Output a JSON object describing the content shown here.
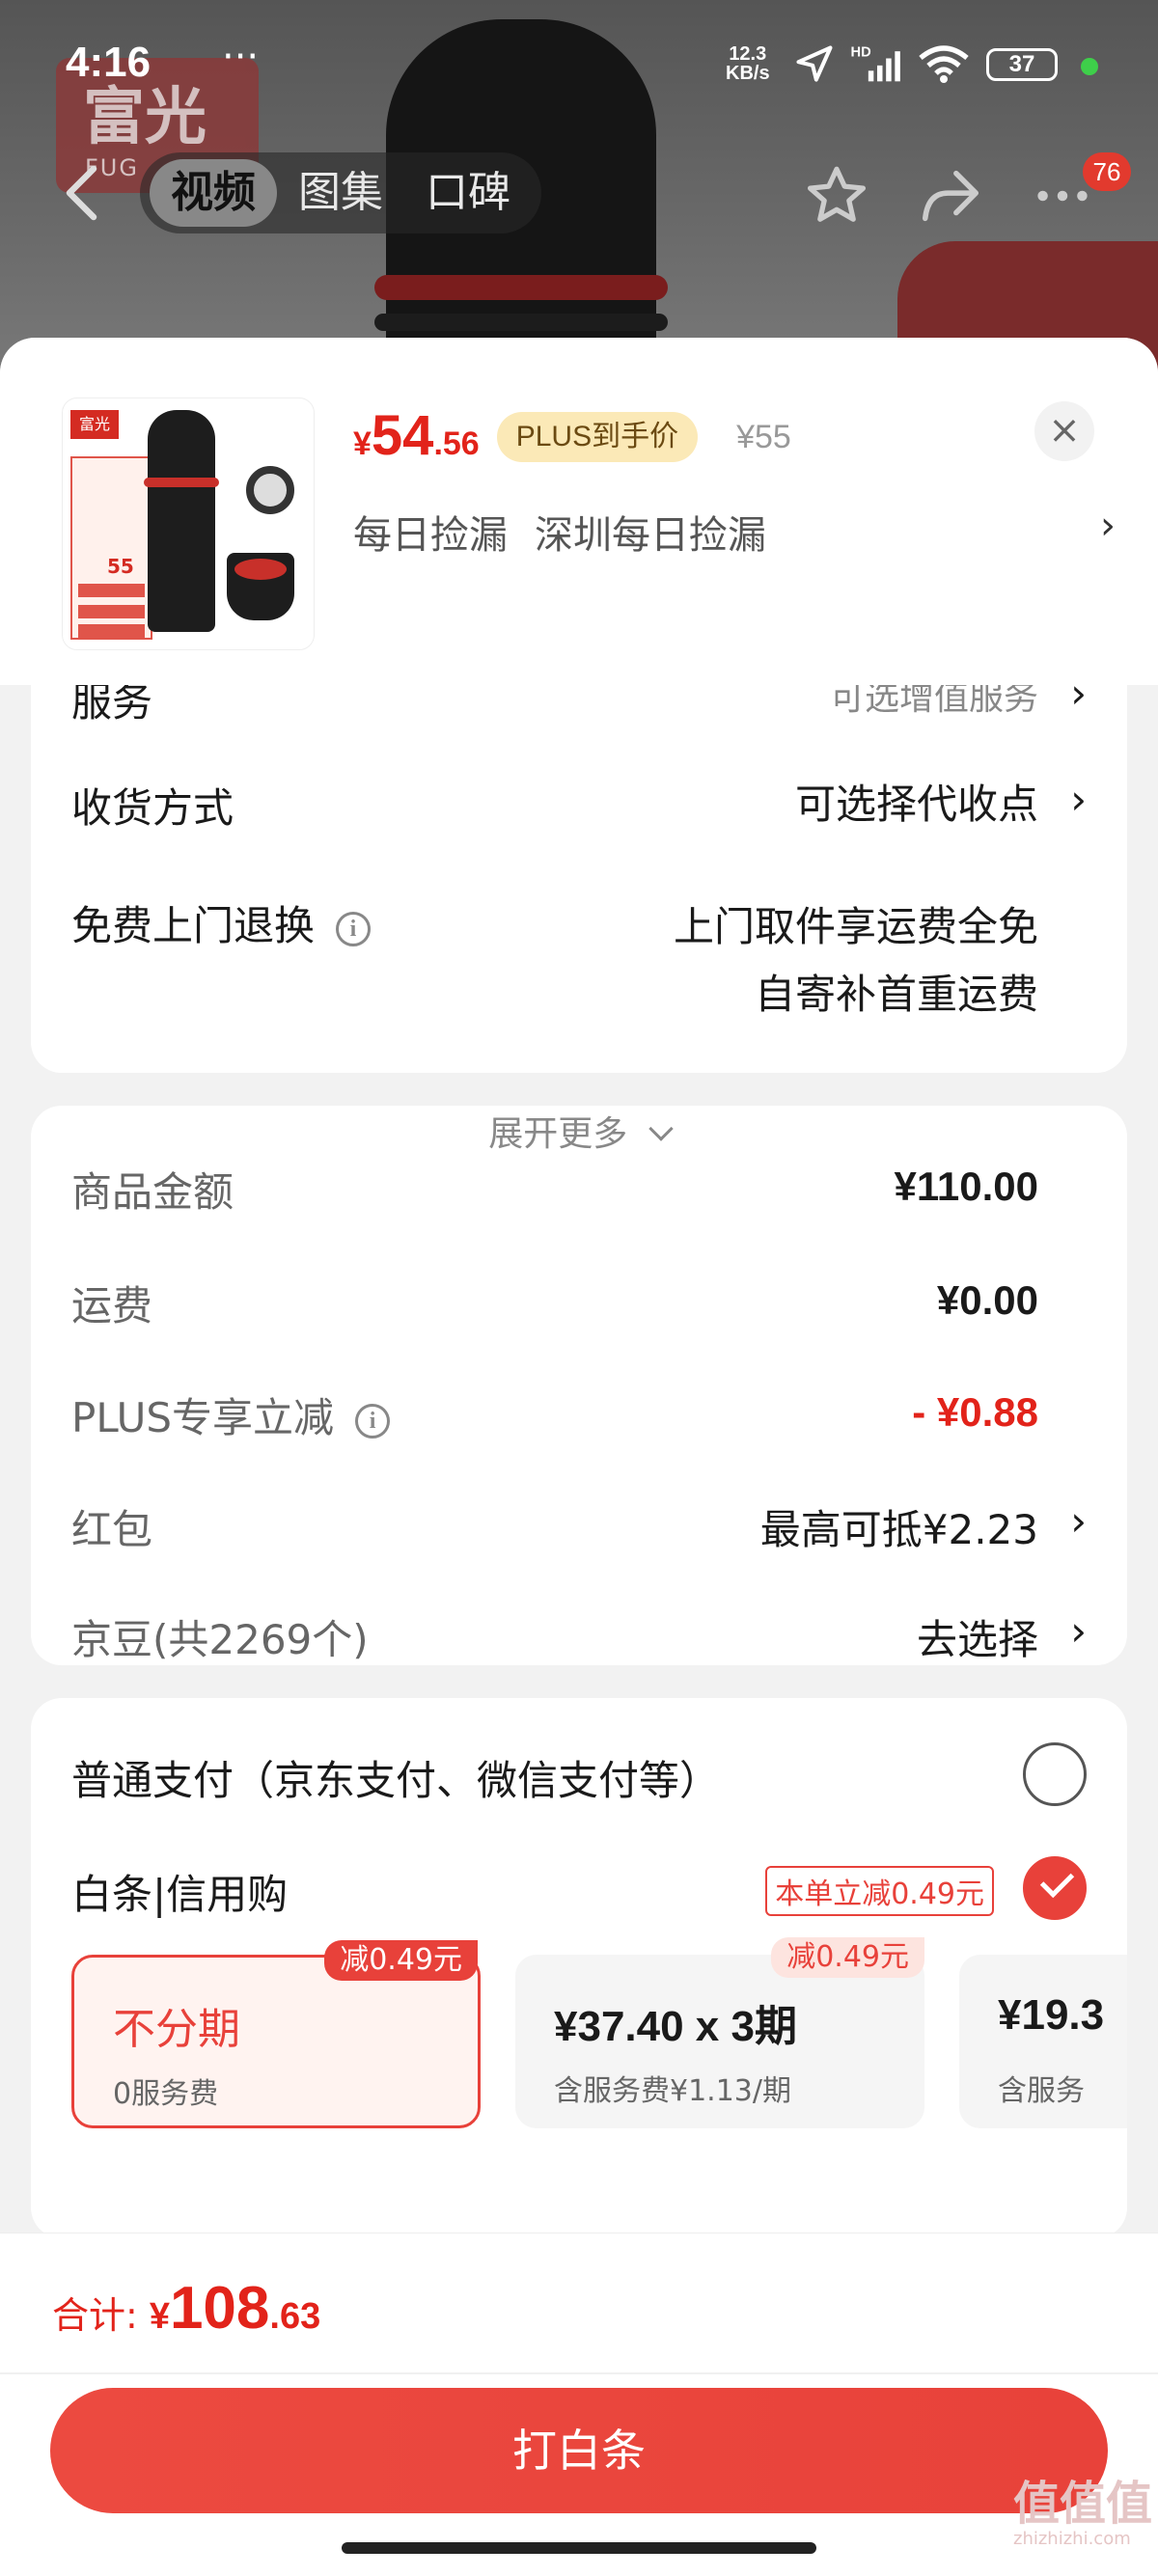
{
  "status": {
    "time": "4:16",
    "dots": "···",
    "speed_value": "12.3",
    "speed_unit": "KB/s",
    "battery": "37"
  },
  "nav": {
    "tabs": [
      "视频",
      "图集",
      "口碑"
    ],
    "badge": "76",
    "logo_text": "富光",
    "logo_sub": "FUG"
  },
  "product": {
    "price_symbol": "¥",
    "price_int": "54",
    "price_dec": ".56",
    "plus_tag": "PLUS到手价",
    "original_price": "¥55",
    "shop_tag1": "每日捡漏",
    "shop_tag2": "深圳每日捡漏",
    "image_label": "富光",
    "image_price": "55"
  },
  "service": {
    "row1_label": "服务",
    "row1_value": "可选增值服务",
    "row2_label": "收货方式",
    "row2_value": "可选择代收点",
    "row3_label": "免费上门退换",
    "row3_value_line1": "上门取件享运费全免",
    "row3_value_line2": "自寄补首重运费"
  },
  "amounts": {
    "goods_label": "商品金额",
    "goods_value": "¥110.00",
    "shipping_label": "运费",
    "shipping_value": "¥0.00",
    "plus_label": "PLUS专享立减",
    "plus_value": "- ¥0.88",
    "redpacket_label": "红包",
    "redpacket_value": "最高可抵¥2.23",
    "beans_label": "京豆(共2269个)",
    "beans_value": "去选择",
    "expand": "展开更多"
  },
  "payment": {
    "normal_label": "普通支付（京东支付、微信支付等）",
    "baitiao_label": "白条|信用购",
    "baitiao_discount": "本单立减0.49元",
    "plans": [
      {
        "tag": "减0.49元",
        "title": "不分期",
        "sub": "0服务费"
      },
      {
        "tag": "减0.49元",
        "title": "¥37.40 x 3期",
        "sub": "含服务费¥1.13/期"
      },
      {
        "tag": "",
        "title": "¥19.3",
        "sub": "含服务"
      }
    ]
  },
  "bottom": {
    "total_label": "合计:",
    "total_symbol": "¥",
    "total_int": "108",
    "total_dec": ".63",
    "pay_button": "打白条",
    "watermark": "值值值",
    "watermark_sub": "zhizhizhi.com"
  },
  "icons": [
    "back-icon",
    "star-icon",
    "share-icon",
    "more-icon",
    "close-icon",
    "info-icon",
    "chevron-right-icon",
    "chevron-down-icon",
    "wifi-icon",
    "signal-icon",
    "location-icon"
  ],
  "colors": {
    "accent": "#e2231a",
    "button": "#e8423a",
    "plus_tag_bg": "#fbe9b7"
  }
}
